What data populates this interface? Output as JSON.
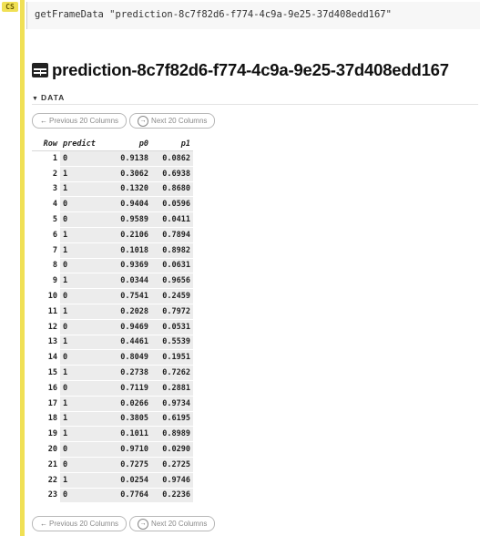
{
  "cell": {
    "prompt_tag": "CS",
    "command": "getFrameData \"prediction-8c7f82d6-f774-4c9a-9e25-37d408edd167\""
  },
  "frame": {
    "title": "prediction-8c7f82d6-f774-4c9a-9e25-37d408edd167",
    "section_label": "DATA",
    "pager_top": {
      "prev_label": "Previous 20 Columns",
      "next_label": "Next 20 Columns"
    },
    "pager_bottom": {
      "prev_label": "Previous 20 Columns",
      "next_label": "Next 20 Columns"
    },
    "columns": [
      "Row",
      "predict",
      "p0",
      "p1"
    ],
    "rows": [
      [
        "1",
        "0",
        "0.9138",
        "0.0862"
      ],
      [
        "2",
        "1",
        "0.3062",
        "0.6938"
      ],
      [
        "3",
        "1",
        "0.1320",
        "0.8680"
      ],
      [
        "4",
        "0",
        "0.9404",
        "0.0596"
      ],
      [
        "5",
        "0",
        "0.9589",
        "0.0411"
      ],
      [
        "6",
        "1",
        "0.2106",
        "0.7894"
      ],
      [
        "7",
        "1",
        "0.1018",
        "0.8982"
      ],
      [
        "8",
        "0",
        "0.9369",
        "0.0631"
      ],
      [
        "9",
        "1",
        "0.0344",
        "0.9656"
      ],
      [
        "10",
        "0",
        "0.7541",
        "0.2459"
      ],
      [
        "11",
        "1",
        "0.2028",
        "0.7972"
      ],
      [
        "12",
        "0",
        "0.9469",
        "0.0531"
      ],
      [
        "13",
        "1",
        "0.4461",
        "0.5539"
      ],
      [
        "14",
        "0",
        "0.8049",
        "0.1951"
      ],
      [
        "15",
        "1",
        "0.2738",
        "0.7262"
      ],
      [
        "16",
        "0",
        "0.7119",
        "0.2881"
      ],
      [
        "17",
        "1",
        "0.0266",
        "0.9734"
      ],
      [
        "18",
        "1",
        "0.3805",
        "0.6195"
      ],
      [
        "19",
        "1",
        "0.1011",
        "0.8989"
      ],
      [
        "20",
        "0",
        "0.9710",
        "0.0290"
      ],
      [
        "21",
        "0",
        "0.7275",
        "0.2725"
      ],
      [
        "22",
        "1",
        "0.0254",
        "0.9746"
      ],
      [
        "23",
        "0",
        "0.7764",
        "0.2236"
      ]
    ]
  },
  "colors": {
    "gutter_accent": "#f0e055",
    "row_fill": "#ececec"
  },
  "icons": {
    "frame_icon": "table-icon",
    "section_caret": "caret-down-icon",
    "prev": "arrow-left-icon",
    "next": "arrow-right-circle-icon"
  }
}
